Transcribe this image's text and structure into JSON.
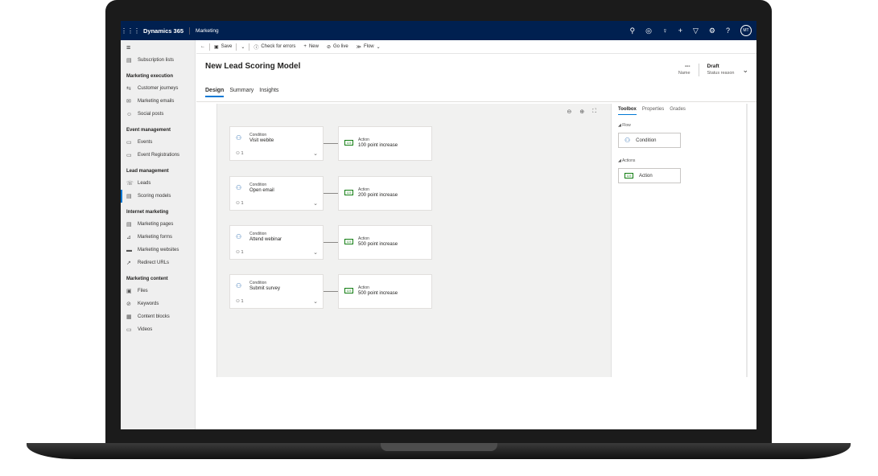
{
  "topbar": {
    "app_name": "Dynamics 365",
    "module": "Marketing",
    "avatar": "MT",
    "icons": [
      "search-icon",
      "target-icon",
      "lightbulb-icon",
      "plus-icon",
      "filter-icon",
      "settings-icon",
      "help-icon"
    ]
  },
  "sidebar": {
    "items_top": [
      {
        "label": "Subscription lists",
        "icon": "list-icon"
      }
    ],
    "groups": [
      {
        "title": "Marketing execution",
        "items": [
          {
            "label": "Customer journeys"
          },
          {
            "label": "Marketing emails"
          },
          {
            "label": "Social posts"
          }
        ]
      },
      {
        "title": "Event management",
        "items": [
          {
            "label": "Events"
          },
          {
            "label": "Event Registrations"
          }
        ]
      },
      {
        "title": "Lead management",
        "items": [
          {
            "label": "Leads"
          },
          {
            "label": "Scoring models"
          }
        ]
      },
      {
        "title": "Internet marketing",
        "items": [
          {
            "label": "Marketing pages"
          },
          {
            "label": "Marketing forms"
          },
          {
            "label": "Marketing websites"
          },
          {
            "label": "Redirect URLs"
          }
        ]
      },
      {
        "title": "Marketing content",
        "items": [
          {
            "label": "Files"
          },
          {
            "label": "Keywords"
          },
          {
            "label": "Content blocks"
          },
          {
            "label": "Videos"
          }
        ]
      }
    ]
  },
  "commands": {
    "save": "Save",
    "check": "Check for errors",
    "new": "New",
    "golive": "Go live",
    "flow": "Flow"
  },
  "record": {
    "title": "New Lead Scoring Model",
    "name_value": "---",
    "name_label": "Name",
    "status_value": "Draft",
    "status_label": "Status reason"
  },
  "tabs": [
    "Design",
    "Summary",
    "Insights"
  ],
  "canvas": {
    "rows": [
      {
        "cond_type": "Condition",
        "cond_name": "Visit webite",
        "count": "1",
        "act_type": "Action",
        "act_name": "100 point increase"
      },
      {
        "cond_type": "Condition",
        "cond_name": "Open email",
        "count": "1",
        "act_type": "Action",
        "act_name": "200 point increase"
      },
      {
        "cond_type": "Condition",
        "cond_name": "Attend webinar",
        "count": "1",
        "act_type": "Action",
        "act_name": "500 point increase"
      },
      {
        "cond_type": "Condition",
        "cond_name": "Submit survey",
        "count": "1",
        "act_type": "Action",
        "act_name": "500 point increase"
      }
    ]
  },
  "toolbox": {
    "tabs": [
      "Toolbox",
      "Properties",
      "Grades"
    ],
    "flow_section": "◢ Flow",
    "flow_item": "Condition",
    "actions_section": "◢ Actions",
    "action_item": "Action"
  }
}
